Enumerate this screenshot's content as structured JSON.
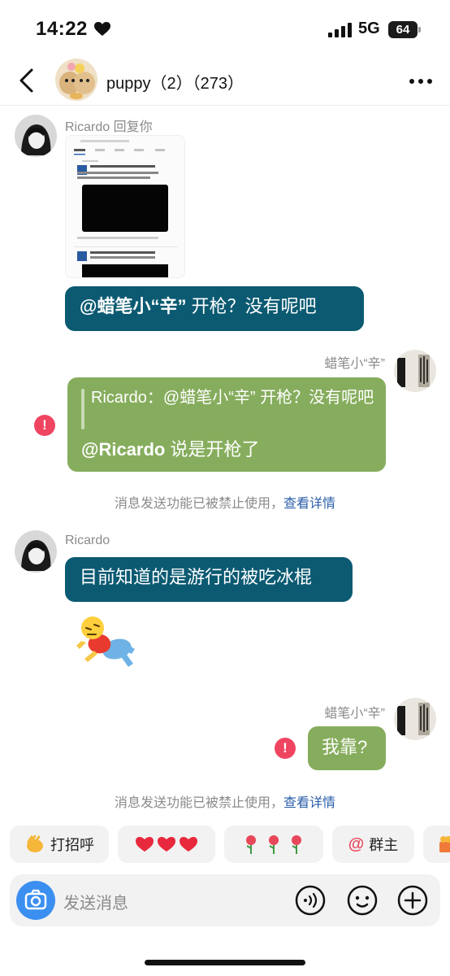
{
  "status_bar": {
    "time": "14:22",
    "network": "5G",
    "battery": "64"
  },
  "header": {
    "title": "puppy（2）（273）"
  },
  "messages": {
    "m1": {
      "sender": "Ricardo 回复你",
      "mention": "@蜡笔小“辛”",
      "text": " 开枪？没有呢吧"
    },
    "m2": {
      "sender": "蜡笔小“辛”",
      "quote": "Ricardo：@蜡笔小“辛” 开枪？没有呢吧",
      "mention": "@Ricardo",
      "text": " 说是开枪了"
    },
    "system1": {
      "text": "消息发送功能已被禁止使用，",
      "link": "查看详情"
    },
    "m3": {
      "sender": "Ricardo",
      "text": "目前知道的是游行的被吃冰棍"
    },
    "m4": {
      "sender": "蜡笔小“辛”",
      "text": "我靠?"
    },
    "system2": {
      "text": "消息发送功能已被禁止使用，",
      "link": "查看详情"
    }
  },
  "quick_replies": [
    "打招呼",
    "",
    "",
    "群主"
  ],
  "input": {
    "placeholder": "发送消息"
  },
  "colors": {
    "teal_bubble": "#0b5a72",
    "green_bubble": "#86ad5d",
    "error": "#ef4561",
    "link": "#2a5ea8"
  },
  "icons": [
    "heart-icon",
    "signal-icon",
    "back-icon",
    "more-icon",
    "error-icon",
    "camera-icon",
    "voice-icon",
    "emoji-icon",
    "plus-icon"
  ]
}
